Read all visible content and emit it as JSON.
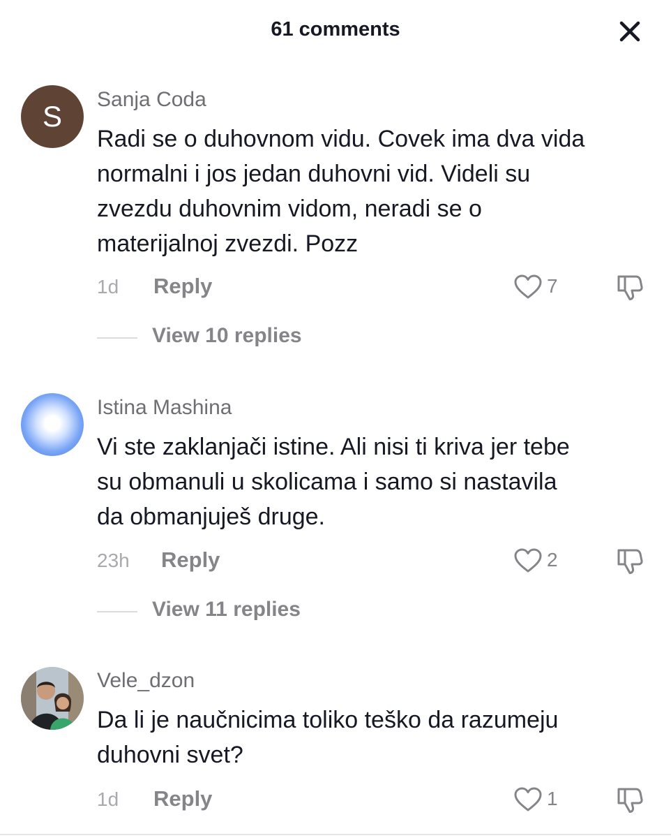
{
  "header": {
    "title": "61 comments",
    "close_icon": "close-icon"
  },
  "comments": [
    {
      "avatar_letter": "S",
      "avatar_color": "#5f4335",
      "username": "Sanja Coda",
      "text_lines": [
        "Radi se o duhovnom vidu. Covek ima dva vida",
        "normalni i jos jedan duhovni vid. Videli su",
        "zvezdu duhovnim vidom, neradi se o",
        "materijalnoj zvezdi. Pozz"
      ],
      "time": "1d",
      "reply_label": "Reply",
      "likes": "7",
      "view_replies": "View 10 replies"
    },
    {
      "avatar_color": "#3f73e6",
      "username": "Istina Mashina",
      "text_lines": [
        "Vi ste zaklanjači istine. Ali nisi ti kriva jer tebe",
        "su obmanuli u skolicama i samo si nastavila",
        "da obmanjuješ druge."
      ],
      "time": "23h",
      "reply_label": "Reply",
      "likes": "2",
      "view_replies": "View 11 replies"
    },
    {
      "username": "Vele_dzon",
      "text_lines": [
        "Da li je naučnicima toliko teško da razumeju",
        "duhovni svet?"
      ],
      "time": "1d",
      "reply_label": "Reply",
      "likes": "1"
    }
  ],
  "icons": {
    "like": "heart-outline-icon",
    "dislike": "thumbs-down-icon"
  },
  "colors": {
    "text": "#161823",
    "secondary": "#858589",
    "muted": "#a9a9ae"
  }
}
